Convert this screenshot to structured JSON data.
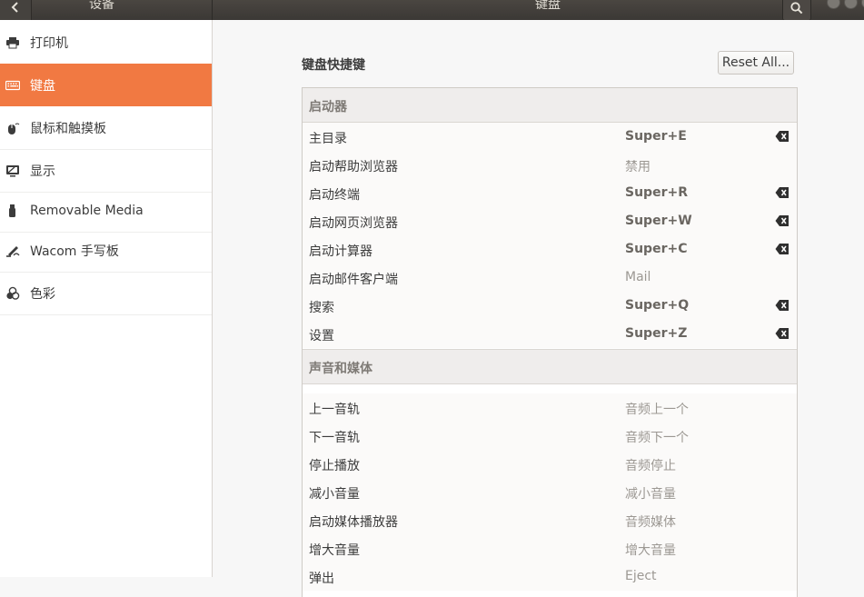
{
  "header": {
    "back_icon": "back-arrow-icon",
    "left_title": "设备",
    "center_title": "键盘",
    "search_icon": "search-icon"
  },
  "sidebar": {
    "items": [
      {
        "label": "打印机",
        "icon": "printer-icon",
        "selected": false
      },
      {
        "label": "键盘",
        "icon": "keyboard-icon",
        "selected": true
      },
      {
        "label": "鼠标和触摸板",
        "icon": "mouse-icon",
        "selected": false
      },
      {
        "label": "显示",
        "icon": "display-icon",
        "selected": false
      },
      {
        "label": "Removable Media",
        "icon": "usb-drive-icon",
        "selected": false
      },
      {
        "label": "Wacom 手写板",
        "icon": "tablet-pen-icon",
        "selected": false
      },
      {
        "label": "色彩",
        "icon": "color-icon",
        "selected": false
      }
    ]
  },
  "main": {
    "title": "键盘快捷键",
    "reset_label": "Reset All...",
    "groups": [
      {
        "header": "启动器",
        "rows": [
          {
            "name": "主目录",
            "accel": "Super+E",
            "set": true
          },
          {
            "name": "启动帮助浏览器",
            "accel": "禁用",
            "set": false
          },
          {
            "name": "启动终端",
            "accel": "Super+R",
            "set": true
          },
          {
            "name": "启动网页浏览器",
            "accel": "Super+W",
            "set": true
          },
          {
            "name": "启动计算器",
            "accel": "Super+C",
            "set": true
          },
          {
            "name": "启动邮件客户端",
            "accel": "Mail",
            "set": false
          },
          {
            "name": "搜索",
            "accel": "Super+Q",
            "set": true
          },
          {
            "name": "设置",
            "accel": "Super+Z",
            "set": true
          }
        ]
      },
      {
        "header": "声音和媒体",
        "rows": [
          {
            "name": "上一音轨",
            "accel": "音频上一个",
            "set": false
          },
          {
            "name": "下一音轨",
            "accel": "音频下一个",
            "set": false
          },
          {
            "name": "停止播放",
            "accel": "音频停止",
            "set": false
          },
          {
            "name": "减小音量",
            "accel": "减小音量",
            "set": false
          },
          {
            "name": "启动媒体播放器",
            "accel": "音频媒体",
            "set": false
          },
          {
            "name": "增大音量",
            "accel": "增大音量",
            "set": false
          },
          {
            "name": "弹出",
            "accel": "Eject",
            "set": false
          }
        ]
      }
    ]
  },
  "colors": {
    "accent": "#f17942",
    "headerbar": "#3e3b38",
    "sidebar_bg": "#ffffff",
    "main_bg": "#f7f7f7"
  }
}
